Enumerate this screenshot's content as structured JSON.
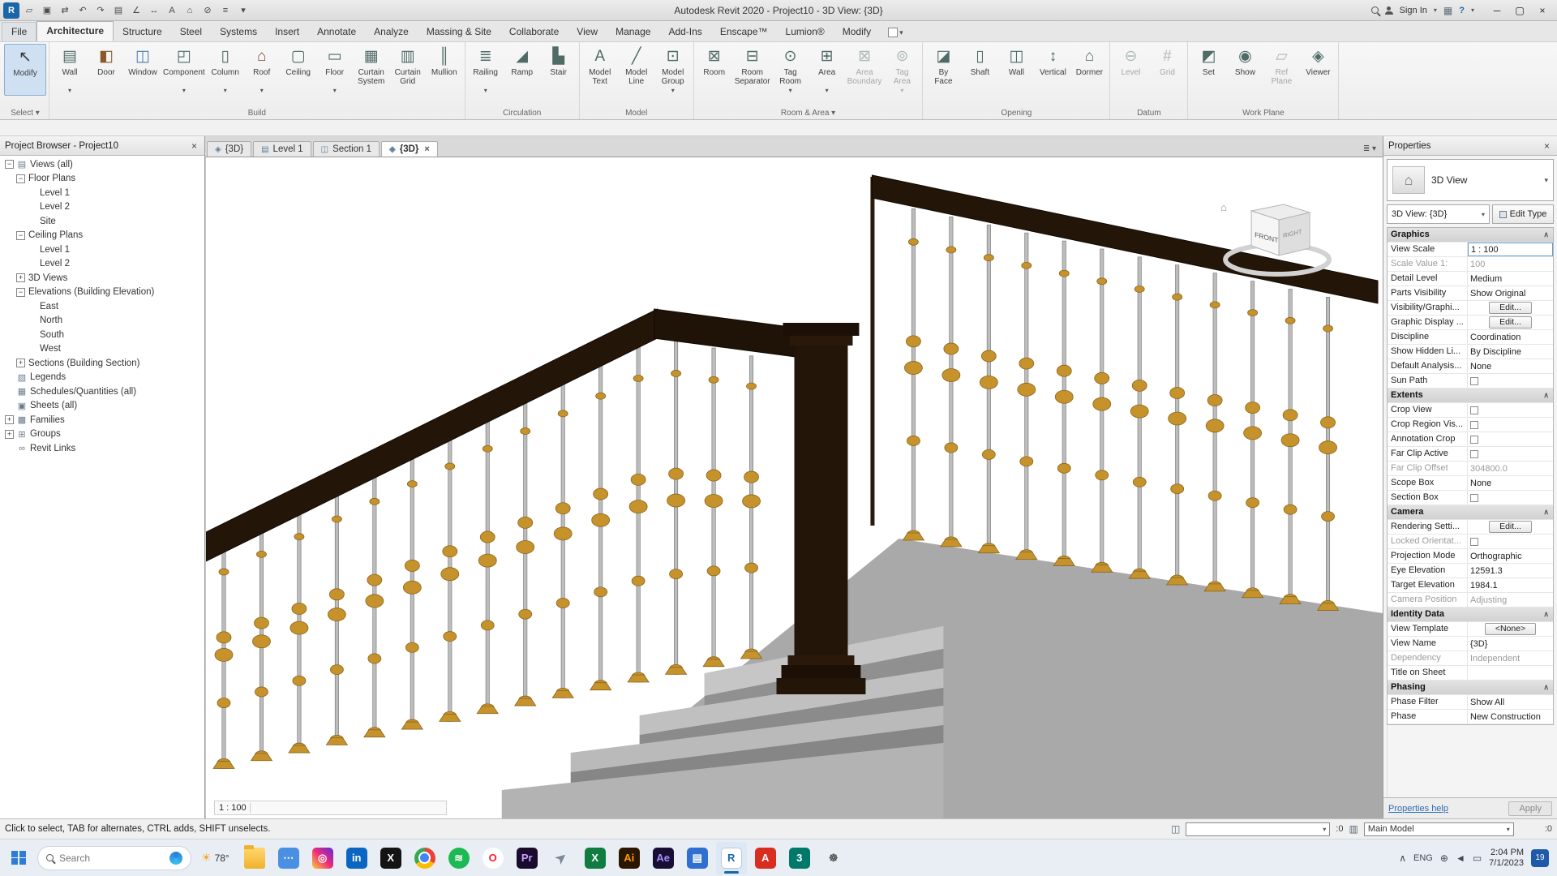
{
  "window": {
    "title": "Autodesk Revit 2020 - Project10 - 3D View: {3D}",
    "sign_in": "Sign In",
    "help_label": "?"
  },
  "qat": {
    "items": [
      {
        "name": "app-logo",
        "glyph": "R",
        "kind": "logo"
      },
      {
        "name": "open-icon",
        "glyph": "▱"
      },
      {
        "name": "save-icon",
        "glyph": "▣"
      },
      {
        "name": "sync-icon",
        "glyph": "⇄"
      },
      {
        "name": "undo-icon",
        "glyph": "↶"
      },
      {
        "name": "redo-icon",
        "glyph": "↷"
      },
      {
        "name": "print-icon",
        "glyph": "▤"
      },
      {
        "name": "measure-icon",
        "glyph": "∠"
      },
      {
        "name": "aligned-dimension-icon",
        "glyph": "↔"
      },
      {
        "name": "text-icon",
        "glyph": "A"
      },
      {
        "name": "default-3d-view-icon",
        "glyph": "⌂"
      },
      {
        "name": "section-icon",
        "glyph": "⊘"
      },
      {
        "name": "thin-lines-icon",
        "glyph": "≡"
      },
      {
        "name": "customize-qat-icon",
        "glyph": "▾"
      }
    ]
  },
  "ribbon": {
    "tabs": [
      {
        "label": "File",
        "kind": "file"
      },
      {
        "label": "Architecture",
        "active": true
      },
      {
        "label": "Structure"
      },
      {
        "label": "Steel"
      },
      {
        "label": "Systems"
      },
      {
        "label": "Insert"
      },
      {
        "label": "Annotate"
      },
      {
        "label": "Analyze"
      },
      {
        "label": "Massing & Site"
      },
      {
        "label": "Collaborate"
      },
      {
        "label": "View"
      },
      {
        "label": "Manage"
      },
      {
        "label": "Add-Ins"
      },
      {
        "label": "Enscape™"
      },
      {
        "label": "Lumion®"
      },
      {
        "label": "Modify"
      }
    ],
    "select": {
      "panel_label": "Select ▾",
      "modify_label": "Modify",
      "modify_glyph": "↖"
    },
    "panels": [
      {
        "label": "Build",
        "buttons": [
          {
            "label": "Wall",
            "glyph": "▤",
            "arrow": true
          },
          {
            "label": "Door",
            "glyph": "◧",
            "fg": "#8a5a2b"
          },
          {
            "label": "Window",
            "glyph": "◫",
            "fg": "#4a7fb5"
          },
          {
            "label": "Component",
            "glyph": "◰",
            "arrow": true
          },
          {
            "label": "Column",
            "glyph": "▯",
            "arrow": true
          },
          {
            "label": "Roof",
            "glyph": "⌂",
            "arrow": true,
            "fg": "#7d4a3a"
          },
          {
            "label": "Ceiling",
            "glyph": "▢"
          },
          {
            "label": "Floor",
            "glyph": "▭",
            "arrow": true
          },
          {
            "label": "Curtain\nSystem",
            "glyph": "▦"
          },
          {
            "label": "Curtain\nGrid",
            "glyph": "▥"
          },
          {
            "label": "Mullion",
            "glyph": "║"
          }
        ]
      },
      {
        "label": "Circulation",
        "buttons": [
          {
            "label": "Railing",
            "glyph": "≣",
            "arrow": true
          },
          {
            "label": "Ramp",
            "glyph": "◢"
          },
          {
            "label": "Stair",
            "glyph": "▙"
          }
        ]
      },
      {
        "label": "Model",
        "buttons": [
          {
            "label": "Model\nText",
            "glyph": "A"
          },
          {
            "label": "Model\nLine",
            "glyph": "╱"
          },
          {
            "label": "Model\nGroup",
            "glyph": "⊡",
            "arrow": true
          }
        ]
      },
      {
        "label": "Room & Area ▾",
        "buttons": [
          {
            "label": "Room",
            "glyph": "⊠"
          },
          {
            "label": "Room\nSeparator",
            "glyph": "⊟"
          },
          {
            "label": "Tag\nRoom",
            "glyph": "⊙",
            "arrow": true
          },
          {
            "label": "Area",
            "glyph": "⊞",
            "arrow": true
          },
          {
            "label": "Area\nBoundary",
            "glyph": "⊠",
            "disabled": true
          },
          {
            "label": "Tag\nArea",
            "glyph": "⊚",
            "arrow": true,
            "disabled": true
          }
        ]
      },
      {
        "label": "Opening",
        "buttons": [
          {
            "label": "By\nFace",
            "glyph": "◪"
          },
          {
            "label": "Shaft",
            "glyph": "▯"
          },
          {
            "label": "Wall",
            "glyph": "◫"
          },
          {
            "label": "Vertical",
            "glyph": "↕"
          },
          {
            "label": "Dormer",
            "glyph": "⌂"
          }
        ]
      },
      {
        "label": "Datum",
        "buttons": [
          {
            "label": "Level",
            "glyph": "⊖",
            "disabled": true
          },
          {
            "label": "Grid",
            "glyph": "#",
            "disabled": true
          }
        ]
      },
      {
        "label": "Work Plane",
        "buttons": [
          {
            "label": "Set",
            "glyph": "◩"
          },
          {
            "label": "Show",
            "glyph": "◉"
          },
          {
            "label": "Ref\nPlane",
            "glyph": "▱",
            "disabled": true
          },
          {
            "label": "Viewer",
            "glyph": "◈"
          }
        ]
      }
    ]
  },
  "view_tabs": {
    "items": [
      {
        "glyph": "◈",
        "label": "{3D}"
      },
      {
        "glyph": "▤",
        "label": "Level 1"
      },
      {
        "glyph": "◫",
        "label": "Section 1"
      },
      {
        "glyph": "◈",
        "label": "{3D}",
        "active": true
      }
    ]
  },
  "project_browser": {
    "title": "Project Browser - Project10",
    "items": [
      {
        "label": "Views (all)",
        "level": 0,
        "exp": "minus",
        "glyph": "▤"
      },
      {
        "label": "Floor Plans",
        "level": 1,
        "exp": "minus",
        "glyph": ""
      },
      {
        "label": "Level 1",
        "level": 2,
        "exp": "none",
        "glyph": ""
      },
      {
        "label": "Level 2",
        "level": 2,
        "exp": "none",
        "glyph": ""
      },
      {
        "label": "Site",
        "level": 2,
        "exp": "none",
        "glyph": ""
      },
      {
        "label": "Ceiling Plans",
        "level": 1,
        "exp": "minus",
        "glyph": ""
      },
      {
        "label": "Level 1",
        "level": 2,
        "exp": "none",
        "glyph": ""
      },
      {
        "label": "Level 2",
        "level": 2,
        "exp": "none",
        "glyph": ""
      },
      {
        "label": "3D Views",
        "level": 1,
        "exp": "plus",
        "glyph": ""
      },
      {
        "label": "Elevations (Building Elevation)",
        "level": 1,
        "exp": "minus",
        "glyph": ""
      },
      {
        "label": "East",
        "level": 2,
        "exp": "none",
        "glyph": ""
      },
      {
        "label": "North",
        "level": 2,
        "exp": "none",
        "glyph": ""
      },
      {
        "label": "South",
        "level": 2,
        "exp": "none",
        "glyph": ""
      },
      {
        "label": "West",
        "level": 2,
        "exp": "none",
        "glyph": ""
      },
      {
        "label": "Sections (Building Section)",
        "level": 1,
        "exp": "plus",
        "glyph": ""
      },
      {
        "label": "Legends",
        "level": 0,
        "exp": "none",
        "glyph": "▧"
      },
      {
        "label": "Schedules/Quantities (all)",
        "level": 0,
        "exp": "none",
        "glyph": "▦"
      },
      {
        "label": "Sheets (all)",
        "level": 0,
        "exp": "none",
        "glyph": "▣"
      },
      {
        "label": "Families",
        "level": 0,
        "exp": "plus",
        "glyph": "▩"
      },
      {
        "label": "Groups",
        "level": 0,
        "exp": "plus",
        "glyph": "⊞"
      },
      {
        "label": "Revit Links",
        "level": 0,
        "exp": "none",
        "glyph": "∞"
      }
    ]
  },
  "viewport": {
    "viewcube": {
      "front": "FRONT",
      "right": "RIGHT",
      "home_glyph": "⌂"
    },
    "scale": "1 : 100",
    "controls": [
      {
        "name": "detail-level-icon",
        "glyph": "▤"
      },
      {
        "name": "visual-style-icon",
        "glyph": "◫"
      },
      {
        "name": "sun-path-icon",
        "glyph": "☀"
      },
      {
        "name": "shadows-icon",
        "glyph": "◑"
      },
      {
        "name": "rendering-dialog-icon",
        "glyph": "◔"
      },
      {
        "name": "crop-view-icon",
        "glyph": "▣"
      },
      {
        "name": "crop-region-icon",
        "glyph": "◻"
      },
      {
        "name": "temporary-hide-icon",
        "glyph": "◎"
      },
      {
        "name": "reveal-hidden-icon",
        "glyph": "◉"
      },
      {
        "name": "worksharing-display-icon",
        "glyph": "◐"
      },
      {
        "name": "temporary-view-properties-icon",
        "glyph": "▥"
      },
      {
        "name": "analytical-model-icon",
        "glyph": "◈"
      },
      {
        "name": "constraints-icon",
        "glyph": "▦"
      }
    ]
  },
  "properties": {
    "title": "Properties",
    "type_name": "3D View",
    "type_glyph": "⌂",
    "view_selector": "3D View: {3D}",
    "edit_type_label": "Edit Type",
    "rows": [
      {
        "label": "Graphics",
        "kind": "header"
      },
      {
        "label": "View Scale",
        "value": "1 : 100",
        "kind": "input"
      },
      {
        "label": "Scale Value    1:",
        "value": "100",
        "kind": "text",
        "muted": true
      },
      {
        "label": "Detail Level",
        "value": "Medium",
        "kind": "text"
      },
      {
        "label": "Parts Visibility",
        "value": "Show Original",
        "kind": "text"
      },
      {
        "label": "Visibility/Graphi...",
        "value": "Edit...",
        "kind": "button"
      },
      {
        "label": "Graphic Display ...",
        "value": "Edit...",
        "kind": "button"
      },
      {
        "label": "Discipline",
        "value": "Coordination",
        "kind": "text"
      },
      {
        "label": "Show Hidden Li...",
        "value": "By Discipline",
        "kind": "text"
      },
      {
        "label": "Default Analysis...",
        "value": "None",
        "kind": "text"
      },
      {
        "label": "Sun Path",
        "kind": "check"
      },
      {
        "label": "Extents",
        "kind": "header"
      },
      {
        "label": "Crop View",
        "kind": "check"
      },
      {
        "label": "Crop Region Vis...",
        "kind": "check"
      },
      {
        "label": "Annotation Crop",
        "kind": "check"
      },
      {
        "label": "Far Clip Active",
        "kind": "check"
      },
      {
        "label": "Far Clip Offset",
        "value": "304800.0",
        "kind": "text",
        "muted": true
      },
      {
        "label": "Scope Box",
        "value": "None",
        "kind": "text"
      },
      {
        "label": "Section Box",
        "kind": "check"
      },
      {
        "label": "Camera",
        "kind": "header"
      },
      {
        "label": "Rendering Setti...",
        "value": "Edit...",
        "kind": "button"
      },
      {
        "label": "Locked Orientat...",
        "kind": "check",
        "muted": true
      },
      {
        "label": "Projection Mode",
        "value": "Orthographic",
        "kind": "text"
      },
      {
        "label": "Eye Elevation",
        "value": "12591.3",
        "kind": "text"
      },
      {
        "label": "Target Elevation",
        "value": "1984.1",
        "kind": "text"
      },
      {
        "label": "Camera Position",
        "value": "Adjusting",
        "kind": "text",
        "muted": true
      },
      {
        "label": "Identity Data",
        "kind": "header"
      },
      {
        "label": "View Template",
        "value": "<None>",
        "kind": "button"
      },
      {
        "label": "View Name",
        "value": "{3D}",
        "kind": "text"
      },
      {
        "label": "Dependency",
        "value": "Independent",
        "kind": "text",
        "muted": true
      },
      {
        "label": "Title on Sheet",
        "value": "",
        "kind": "text"
      },
      {
        "label": "Phasing",
        "kind": "header"
      },
      {
        "label": "Phase Filter",
        "value": "Show All",
        "kind": "text"
      },
      {
        "label": "Phase",
        "value": "New Construction",
        "kind": "text"
      }
    ],
    "help": "Properties help",
    "apply": "Apply"
  },
  "status_bar": {
    "message": "Click to select, TAB for alternates, CTRL adds, SHIFT unselects.",
    "worksets_glyph": "◫",
    "active_workset": "",
    "editable_badge": ":0",
    "design_option": "Main Model",
    "right_icons": [
      {
        "name": "select-links-icon",
        "glyph": "⊞"
      },
      {
        "name": "select-underlay-icon",
        "glyph": "◈"
      },
      {
        "name": "select-pinned-icon",
        "glyph": "◻"
      },
      {
        "name": "drag-on-selection-icon",
        "glyph": "◐"
      },
      {
        "name": "filter-icon",
        "glyph": "▽"
      }
    ],
    "filter_badge": ":0"
  },
  "taskbar": {
    "search_placeholder": "Search",
    "weather_temp": "78°",
    "apps": [
      {
        "name": "file-explorer",
        "kind": "explorer",
        "glyph": ""
      },
      {
        "name": "chat-app",
        "bg": "#4a8fe2",
        "fg": "#ffffff",
        "glyph": "⋯"
      },
      {
        "name": "instagram",
        "kind": "instagram",
        "fg": "#ffffff",
        "glyph": "◎"
      },
      {
        "name": "linkedin",
        "bg": "#0a66c2",
        "fg": "#ffffff",
        "glyph": "in"
      },
      {
        "name": "x-app",
        "bg": "#141414",
        "fg": "#ffffff",
        "glyph": "X"
      },
      {
        "name": "chrome",
        "kind": "chrome",
        "glyph": ""
      },
      {
        "name": "spotify",
        "kind": "circle",
        "bg": "#1db954",
        "fg": "#ffffff",
        "glyph": "≋"
      },
      {
        "name": "opera",
        "kind": "circle",
        "bg": "#ffffff",
        "fg": "#ff1b2d",
        "glyph": "O"
      },
      {
        "name": "premiere-pro",
        "bg": "#1a0b2e",
        "fg": "#c9a0ff",
        "glyph": "Pr"
      },
      {
        "name": "paper-plane",
        "kind": "plane",
        "fg": "#7a8a99",
        "glyph": "➤"
      },
      {
        "name": "excel",
        "bg": "#107c41",
        "fg": "#ffffff",
        "glyph": "X"
      },
      {
        "name": "illustrator",
        "bg": "#2b1600",
        "fg": "#ff9a00",
        "glyph": "Ai"
      },
      {
        "name": "after-effects",
        "bg": "#180d33",
        "fg": "#9f93ff",
        "glyph": "Ae"
      },
      {
        "name": "notes-app",
        "bg": "#2f6fd0",
        "fg": "#ffffff",
        "glyph": "▤"
      },
      {
        "name": "revit",
        "kind": "revitapp",
        "active": true,
        "fg": "#1a66a8",
        "glyph": "R"
      },
      {
        "name": "acrobat",
        "bg": "#d92d20",
        "fg": "#ffffff",
        "glyph": "A"
      },
      {
        "name": "3ds-max",
        "bg": "#00796b",
        "fg": "#ffffff",
        "glyph": "3"
      },
      {
        "name": "settings",
        "fg": "#555555",
        "glyph": "☸"
      }
    ],
    "tray": {
      "chevron": "∧",
      "language": "ENG",
      "network_glyph": "⊕",
      "volume_glyph": "◄",
      "battery_glyph": "▭",
      "time": "2:04 PM",
      "date": "7/1/2023",
      "badge": "19"
    }
  }
}
